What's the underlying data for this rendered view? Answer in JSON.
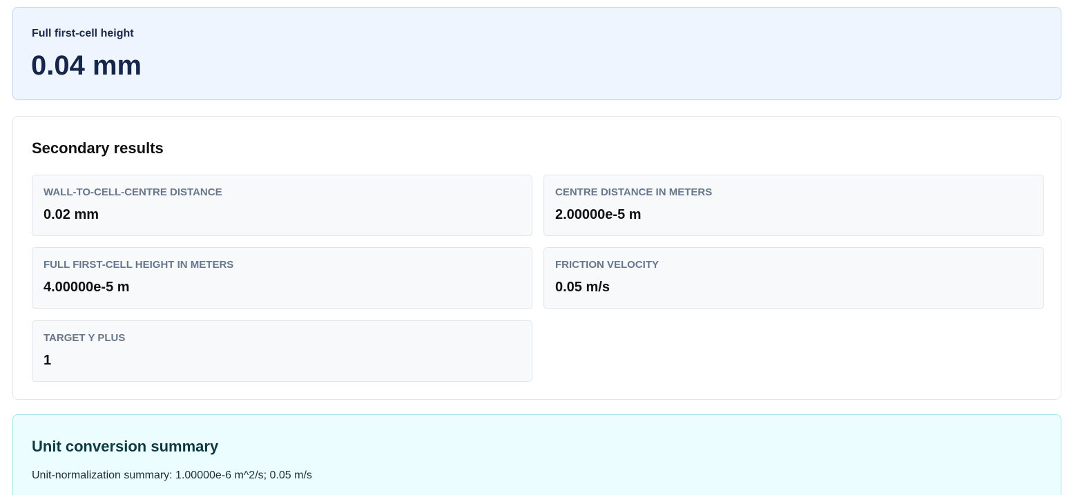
{
  "primary": {
    "label": "Full first-cell height",
    "value": "0.04 mm"
  },
  "secondary": {
    "title": "Secondary results",
    "metrics": [
      {
        "label": "Wall-to-cell-centre distance",
        "value": "0.02 mm"
      },
      {
        "label": "Centre distance in meters",
        "value": "2.00000e-5 m"
      },
      {
        "label": "Full first-cell height in meters",
        "value": "4.00000e-5 m"
      },
      {
        "label": "Friction velocity",
        "value": "0.05 m/s"
      },
      {
        "label": "Target y plus",
        "value": "1"
      }
    ]
  },
  "unit_conversion": {
    "title": "Unit conversion summary",
    "summary": "Unit-normalization summary: 1.00000e-6 m^2/s; 0.05 m/s"
  },
  "colors": {
    "primary_bg": "#eef5ff",
    "unit_bg": "#ebfdfe",
    "label_gray": "#66768c",
    "dark_navy": "#15264a"
  }
}
